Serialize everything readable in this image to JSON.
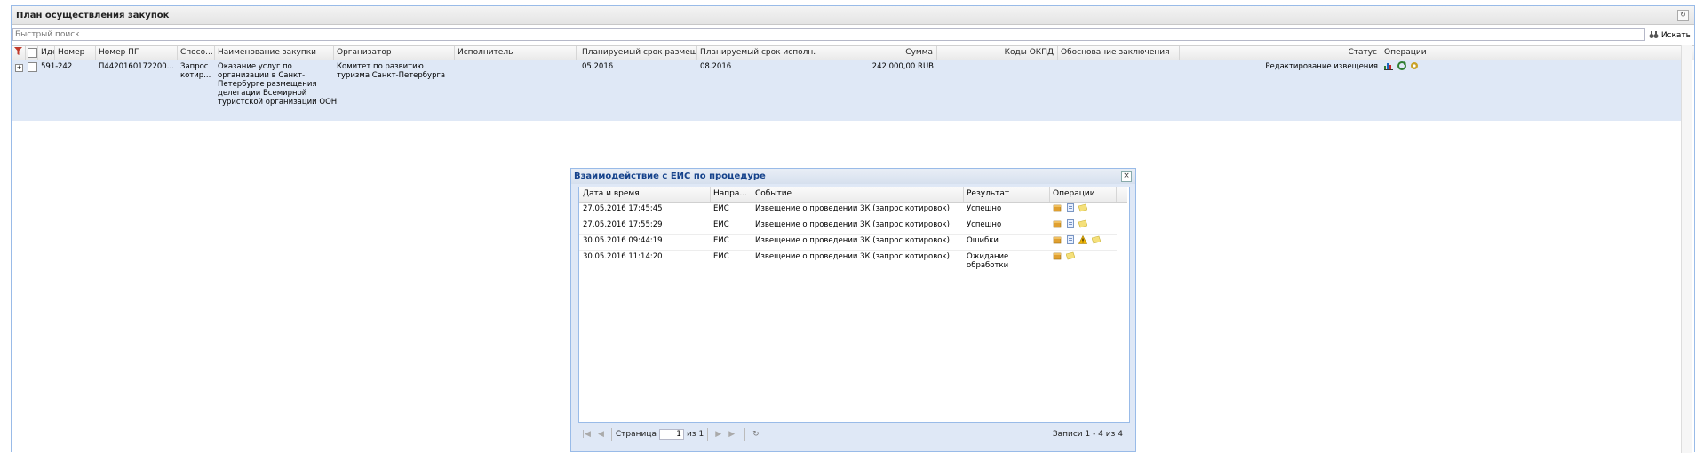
{
  "panel": {
    "title": "План осуществления закупок"
  },
  "search": {
    "placeholder": "Быстрый поиск",
    "button_label": "Искать",
    "button_icon": "binoculars-icon"
  },
  "grid": {
    "columns": [
      "Иде",
      "Номер",
      "Номер ПГ",
      "Спосо...",
      "Наименование закупки",
      "Организатор",
      "Исполнитель",
      "Планируемый срок размещ...",
      "Планируемый срок исполн...",
      "Сумма",
      "Коды ОКПД",
      "Обоснование заключения",
      "Статус",
      "Операции"
    ],
    "row": {
      "id": "591-",
      "number": "242",
      "plan_number": "П4420160172200...",
      "method_lines": [
        "Запрос",
        "котир..."
      ],
      "name_lines": [
        "Оказание услуг по",
        "организации в Санкт-",
        "Петербурге размещения",
        "делегации Всемирной",
        "туристской организации ООН"
      ],
      "organizer_lines": [
        "Комитет по развитию",
        "туризма Санкт-Петербурга"
      ],
      "executor": "",
      "placement_date": "05.2016",
      "execution_date": "08.2016",
      "amount": "242 000,00 RUB",
      "okpd": "",
      "justification": "",
      "status": "Редактирование извещения",
      "operations": [
        "chart-icon",
        "refresh-icon",
        "settings-icon"
      ]
    }
  },
  "modal": {
    "title": "Взаимодействие с ЕИС по процедуре",
    "columns": [
      "Дата и время",
      "Напра...",
      "Событие",
      "Результат",
      "Операции"
    ],
    "rows": [
      {
        "datetime": "27.05.2016 17:45:45",
        "direction": "ЕИС",
        "event": "Извещение о проведении ЗК (запрос котировок)",
        "result_lines": [
          "Успешно"
        ],
        "ops": [
          "package-icon",
          "document-icon",
          "note-icon"
        ]
      },
      {
        "datetime": "27.05.2016 17:55:29",
        "direction": "ЕИС",
        "event": "Извещение о проведении ЗК (запрос котировок)",
        "result_lines": [
          "Успешно"
        ],
        "ops": [
          "package-icon",
          "document-icon",
          "note-icon"
        ]
      },
      {
        "datetime": "30.05.2016 09:44:19",
        "direction": "ЕИС",
        "event": "Извещение о проведении ЗК (запрос котировок)",
        "result_lines": [
          "Ошибки"
        ],
        "ops": [
          "package-icon",
          "document-icon",
          "warning-icon",
          "note-icon"
        ]
      },
      {
        "datetime": "30.05.2016 11:14:20",
        "direction": "ЕИС",
        "event": "Извещение о проведении ЗК (запрос котировок)",
        "result_lines": [
          "Ожидание",
          "обработки"
        ],
        "ops": [
          "package-icon",
          "note-icon"
        ]
      }
    ],
    "pager": {
      "page_label": "Страница",
      "page_value": "1",
      "of_label": "из 1",
      "records": "Записи 1 - 4 из 4"
    }
  },
  "colors": {
    "selected_row": "#dfe8f6",
    "modal_border": "#99bbe8",
    "title_blue": "#15428b"
  }
}
